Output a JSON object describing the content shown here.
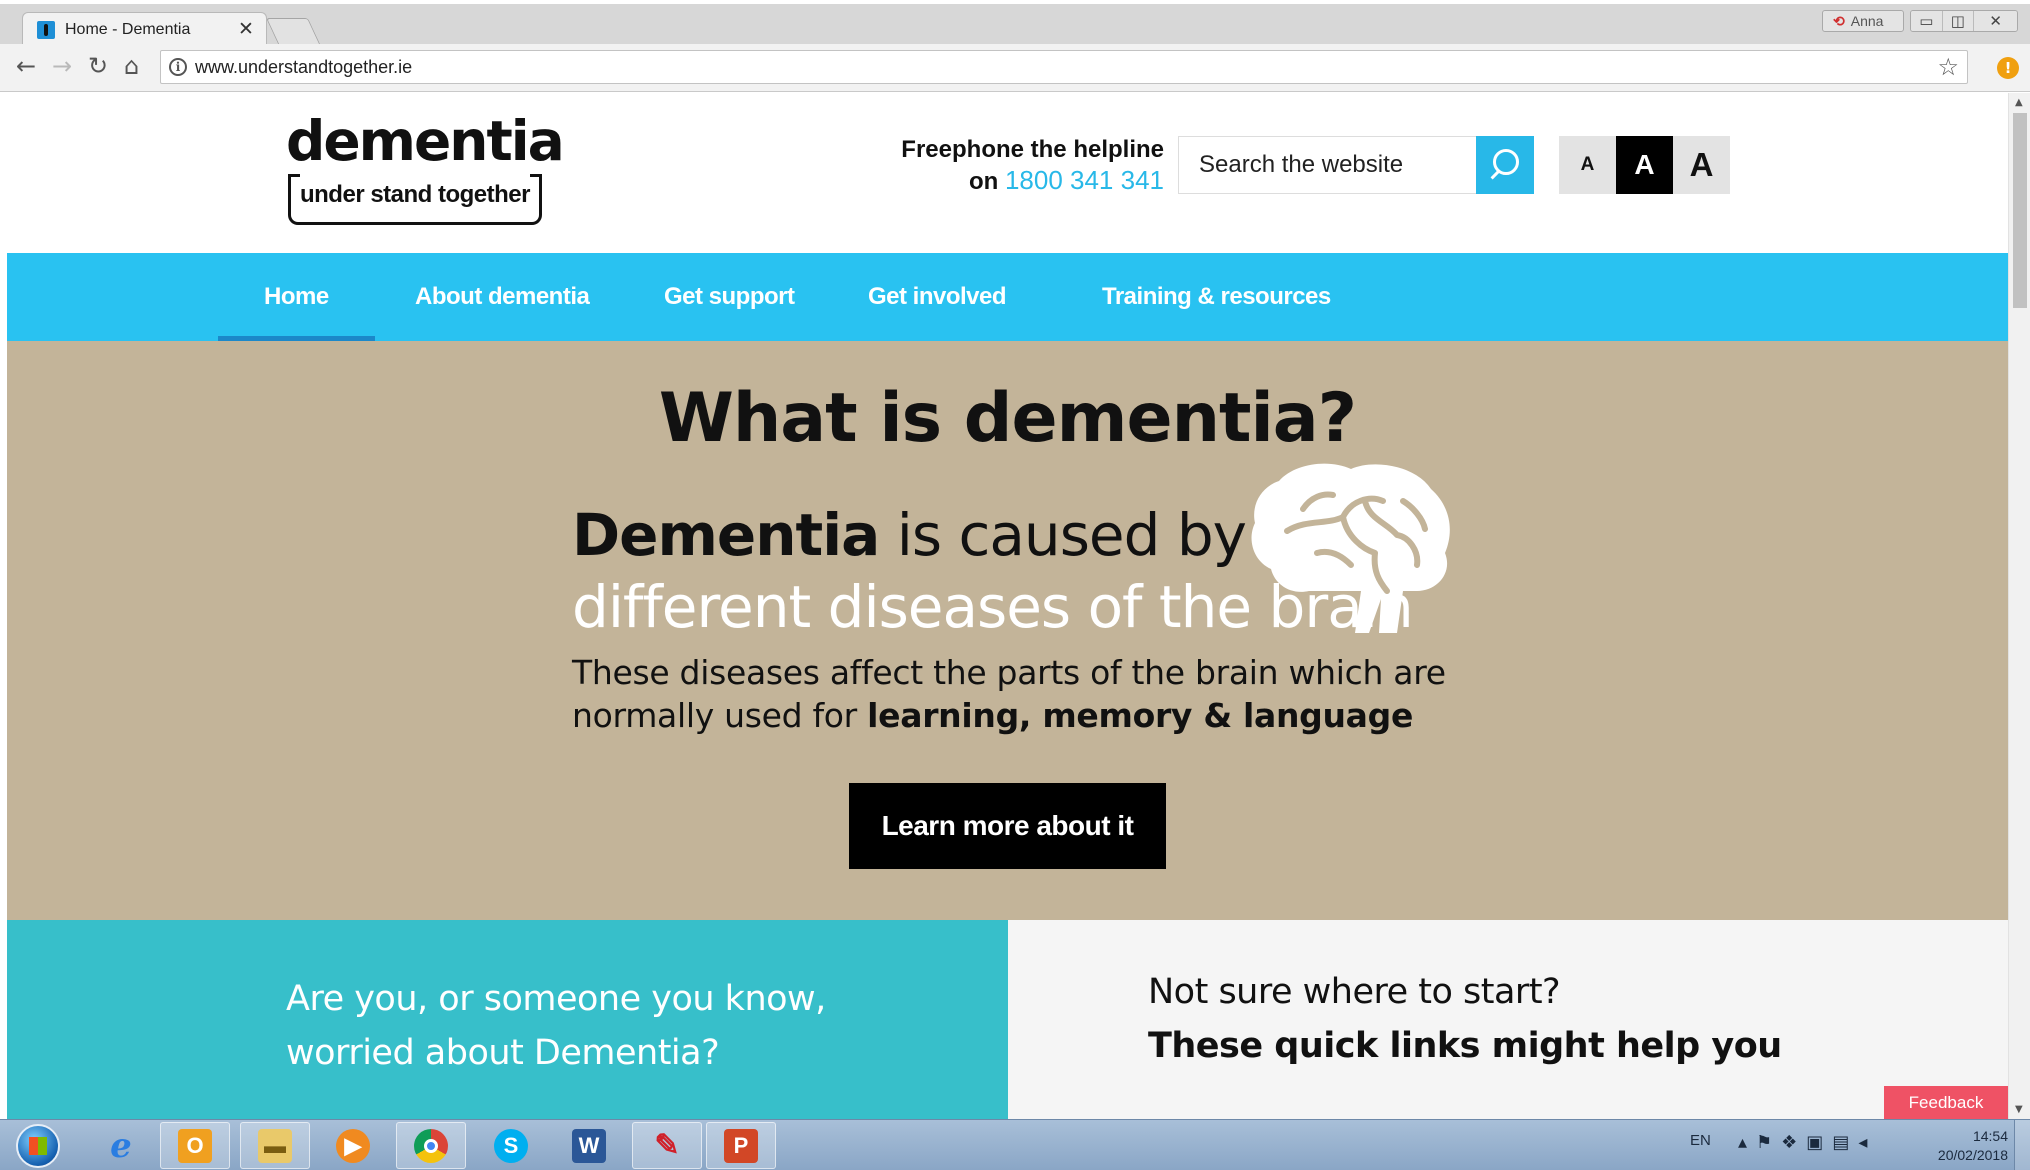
{
  "browser": {
    "tab_title": "Home - Dementia",
    "tab_close": "✕",
    "url": "www.understandtogether.ie",
    "profile_name": "Anna",
    "window_buttons": [
      "▭",
      "◫",
      "✕"
    ]
  },
  "header": {
    "logo_word": "dementia",
    "logo_tagline": "under stand together",
    "helpline_label_1": "Freephone the helpline",
    "helpline_label_2": "on",
    "helpline_number": "1800 341 341",
    "search_placeholder": "Search the website",
    "font_size_labels": [
      "A",
      "A",
      "A"
    ]
  },
  "nav": {
    "items": [
      {
        "label": "Home",
        "active": true
      },
      {
        "label": "About dementia"
      },
      {
        "label": "Get support"
      },
      {
        "label": "Get involved"
      },
      {
        "label": "Training & resources"
      }
    ]
  },
  "hero": {
    "title": "What is dementia?",
    "line1_bold": "Dementia",
    "line1_rest": " is caused by",
    "line2": "different diseases of the brain",
    "para_part1": "These diseases affect the parts of the brain which are normally used for ",
    "para_bold": "learning, memory & language",
    "cta_label": "Learn more about it"
  },
  "panels": {
    "left_text": "Are you, or someone you know, worried about Dementia?",
    "right_line1": "Not sure where to start?",
    "right_line2": "These quick links might help you"
  },
  "feedback_label": "Feedback",
  "taskbar": {
    "apps": [
      "internet-explorer-icon",
      "outlook-icon",
      "file-explorer-icon",
      "media-player-icon",
      "chrome-icon",
      "skype-icon",
      "word-icon",
      "acrobat-icon",
      "powerpoint-icon"
    ],
    "language": "EN",
    "time": "14:54",
    "date": "20/02/2018"
  },
  "colors": {
    "nav_blue": "#29c2f1",
    "hero_tan": "#c3b499",
    "panel_teal": "#37bfca",
    "feedback_red": "#ef5265"
  }
}
